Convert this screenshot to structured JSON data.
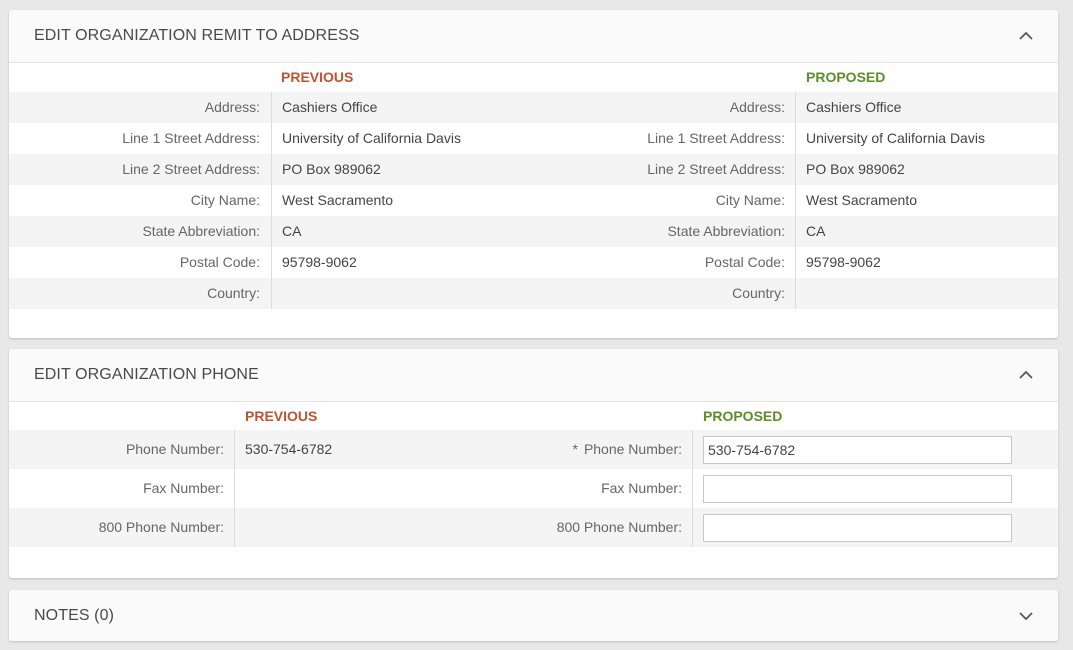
{
  "address_panel": {
    "title": "EDIT ORGANIZATION REMIT TO ADDRESS",
    "previous_label": "PREVIOUS",
    "proposed_label": "PROPOSED",
    "rows": [
      {
        "label": "Address:",
        "previous": "Cashiers Office",
        "proposed": "Cashiers Office"
      },
      {
        "label": "Line 1 Street Address:",
        "previous": "University of California Davis",
        "proposed": "University of California Davis"
      },
      {
        "label": "Line 2 Street Address:",
        "previous": "PO Box 989062",
        "proposed": "PO Box 989062"
      },
      {
        "label": "City Name:",
        "previous": "West Sacramento",
        "proposed": "West Sacramento"
      },
      {
        "label": "State Abbreviation:",
        "previous": "CA",
        "proposed": "CA"
      },
      {
        "label": "Postal Code:",
        "previous": "95798-9062",
        "proposed": "95798-9062"
      },
      {
        "label": "Country:",
        "previous": "",
        "proposed": ""
      }
    ]
  },
  "phone_panel": {
    "title": "EDIT ORGANIZATION PHONE",
    "previous_label": "PREVIOUS",
    "proposed_label": "PROPOSED",
    "required_marker": "*",
    "rows": [
      {
        "label": "Phone Number:",
        "previous": "530-754-6782",
        "proposed": "530-754-6782"
      },
      {
        "label": "Fax Number:",
        "previous": "",
        "proposed": ""
      },
      {
        "label": "800 Phone Number:",
        "previous": "",
        "proposed": ""
      }
    ]
  },
  "notes_panel": {
    "title": "NOTES (0)"
  },
  "colors": {
    "previous": "#c0532e",
    "proposed": "#5a8f25",
    "background": "#e8e8e8"
  },
  "icons": {
    "collapse": "chevron-up-icon",
    "expand": "chevron-down-icon"
  }
}
